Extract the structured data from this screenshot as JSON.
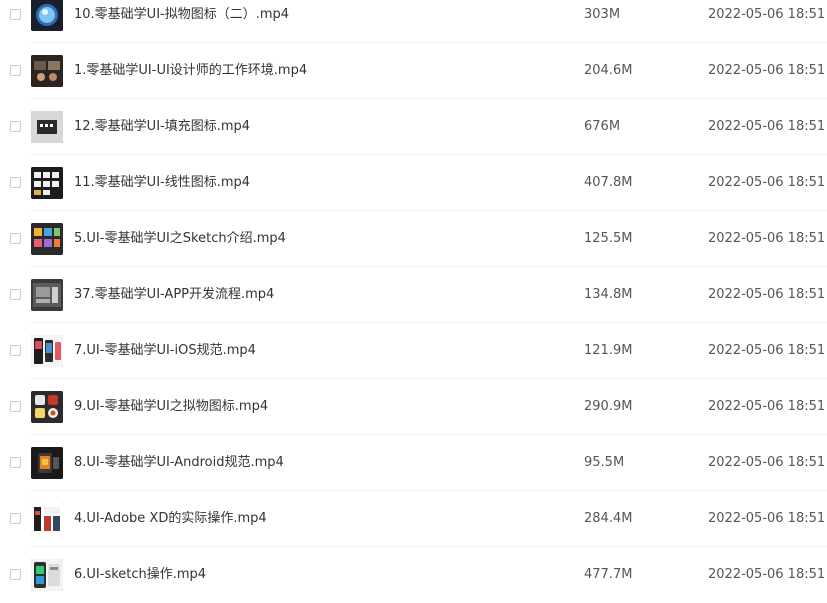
{
  "files": [
    {
      "name": "10.零基础学UI-拟物图标（二）.mp4",
      "size": "303M",
      "modified": "2022-05-06 18:51",
      "thumbnail": "video-thumbnail-round-icon"
    },
    {
      "name": "1.零基础学UI-UI设计师的工作环境.mp4",
      "size": "204.6M",
      "modified": "2022-05-06 18:51",
      "thumbnail": "video-thumbnail-workspace"
    },
    {
      "name": "12.零基础学UI-填充图标.mp4",
      "size": "676M",
      "modified": "2022-05-06 18:51",
      "thumbnail": "video-thumbnail-fill-icons"
    },
    {
      "name": "11.零基础学UI-线性图标.mp4",
      "size": "407.8M",
      "modified": "2022-05-06 18:51",
      "thumbnail": "video-thumbnail-line-icons"
    },
    {
      "name": "5.UI-零基础学UI之Sketch介绍.mp4",
      "size": "125.5M",
      "modified": "2022-05-06 18:51",
      "thumbnail": "video-thumbnail-sketch"
    },
    {
      "name": "37.零基础学UI-APP开发流程.mp4",
      "size": "134.8M",
      "modified": "2022-05-06 18:51",
      "thumbnail": "video-thumbnail-app-dev"
    },
    {
      "name": "7.UI-零基础学UI-iOS规范.mp4",
      "size": "121.9M",
      "modified": "2022-05-06 18:51",
      "thumbnail": "video-thumbnail-ios"
    },
    {
      "name": "9.UI-零基础学UI之拟物图标.mp4",
      "size": "290.9M",
      "modified": "2022-05-06 18:51",
      "thumbnail": "video-thumbnail-skeuomorphic"
    },
    {
      "name": "8.UI-零基础学UI-Android规范.mp4",
      "size": "95.5M",
      "modified": "2022-05-06 18:51",
      "thumbnail": "video-thumbnail-android"
    },
    {
      "name": "4.UI-Adobe XD的实际操作.mp4",
      "size": "284.4M",
      "modified": "2022-05-06 18:51",
      "thumbnail": "video-thumbnail-adobe-xd"
    },
    {
      "name": "6.UI-sketch操作.mp4",
      "size": "477.7M",
      "modified": "2022-05-06 18:51",
      "thumbnail": "video-thumbnail-sketch-ops"
    }
  ]
}
